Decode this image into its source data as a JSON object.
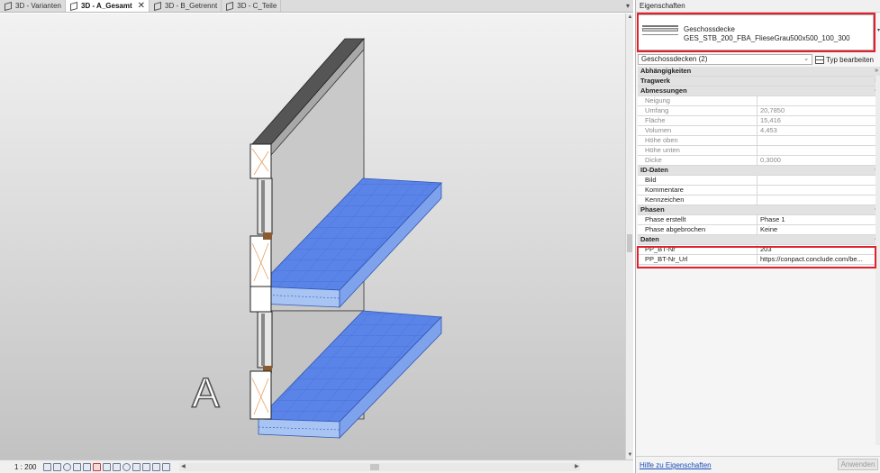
{
  "tabs": [
    {
      "label": "3D - Varianten",
      "active": false
    },
    {
      "label": "3D - A_Gesamt",
      "active": true
    },
    {
      "label": "3D - B_Getrennt",
      "active": false
    },
    {
      "label": "3D - C_Teile",
      "active": false
    }
  ],
  "tab_close_glyph": "✕",
  "viewport": {
    "annotation_letter": "A"
  },
  "status_bar": {
    "scale": "1 : 200",
    "icons": [
      "view-scale-icon",
      "detail-level-icon",
      "visual-style-icon",
      "sun-path-icon",
      "shadows-icon",
      "render-icon",
      "crop-view-icon",
      "show-crop-icon",
      "unlock-3d-icon",
      "temporary-hide-icon",
      "reveal-hidden-icon",
      "analytical-model-icon",
      "highlight-displacement-icon",
      "reveal-constraints-icon"
    ]
  },
  "properties": {
    "title": "Eigenschaften",
    "type_family": "Geschossdecke",
    "type_name": "GES_STB_200_FBA_FlieseGrau500x500_100_300",
    "instance_selector": "Geschossdecken (2)",
    "edit_type_label": "Typ bearbeiten",
    "groups": [
      {
        "label": "Abhängigkeiten",
        "collapsed": true,
        "rows": []
      },
      {
        "label": "Tragwerk",
        "collapsed": true,
        "rows": []
      },
      {
        "label": "Abmessungen",
        "collapsed": false,
        "rows": [
          {
            "name": "Neigung",
            "value": "",
            "readonly": true
          },
          {
            "name": "Umfang",
            "value": "20,7850",
            "readonly": true
          },
          {
            "name": "Fläche",
            "value": "15,416",
            "readonly": true
          },
          {
            "name": "Volumen",
            "value": "4,453",
            "readonly": true
          },
          {
            "name": "Höhe oben",
            "value": "",
            "readonly": true
          },
          {
            "name": "Höhe unten",
            "value": "",
            "readonly": true
          },
          {
            "name": "Dicke",
            "value": "0,3000",
            "readonly": true
          }
        ]
      },
      {
        "label": "ID-Daten",
        "collapsed": false,
        "rows": [
          {
            "name": "Bild",
            "value": "",
            "readonly": false
          },
          {
            "name": "Kommentare",
            "value": "",
            "readonly": false
          },
          {
            "name": "Kennzeichen",
            "value": "",
            "readonly": false
          }
        ]
      },
      {
        "label": "Phasen",
        "collapsed": false,
        "rows": [
          {
            "name": "Phase erstellt",
            "value": "Phase 1",
            "readonly": false
          },
          {
            "name": "Phase abgebrochen",
            "value": "Keine",
            "readonly": false
          }
        ]
      },
      {
        "label": "Daten",
        "collapsed": false,
        "rows": [
          {
            "name": "PP_BT-Nr",
            "value": "203",
            "readonly": false
          },
          {
            "name": "PP_BT-Nr_Url",
            "value": "https://conpact.conclude.com/be...",
            "readonly": false
          }
        ]
      }
    ],
    "help_link": "Hilfe zu Eigenschaften",
    "apply_button": "Anwenden"
  },
  "colors": {
    "highlight": "#e0202a",
    "slab_blue": "#5b84e8",
    "link": "#1a4db8"
  }
}
